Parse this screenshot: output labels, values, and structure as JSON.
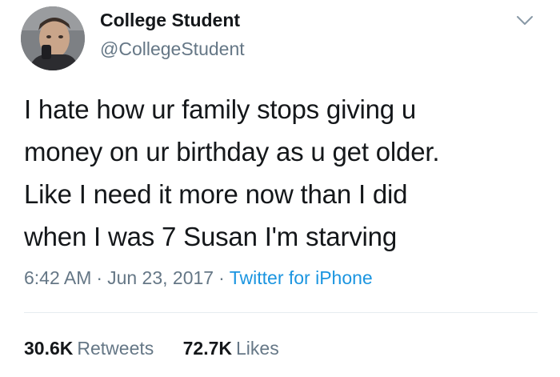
{
  "user": {
    "display_name": "College Student",
    "handle": "@CollegeStudent"
  },
  "tweet": {
    "lines": [
      "I hate how ur family stops giving u",
      "money on ur birthday as u get older.",
      "Like I need it more now than I did",
      "when I was 7 Susan I'm starving"
    ],
    "time": "6:42 AM",
    "date": "Jun 23, 2017",
    "source": "Twitter for iPhone",
    "separator": "·"
  },
  "stats": {
    "retweets_count": "30.6K",
    "retweets_label": "Retweets",
    "likes_count": "72.7K",
    "likes_label": "Likes"
  },
  "icons": {
    "more": "chevron-down-icon"
  }
}
